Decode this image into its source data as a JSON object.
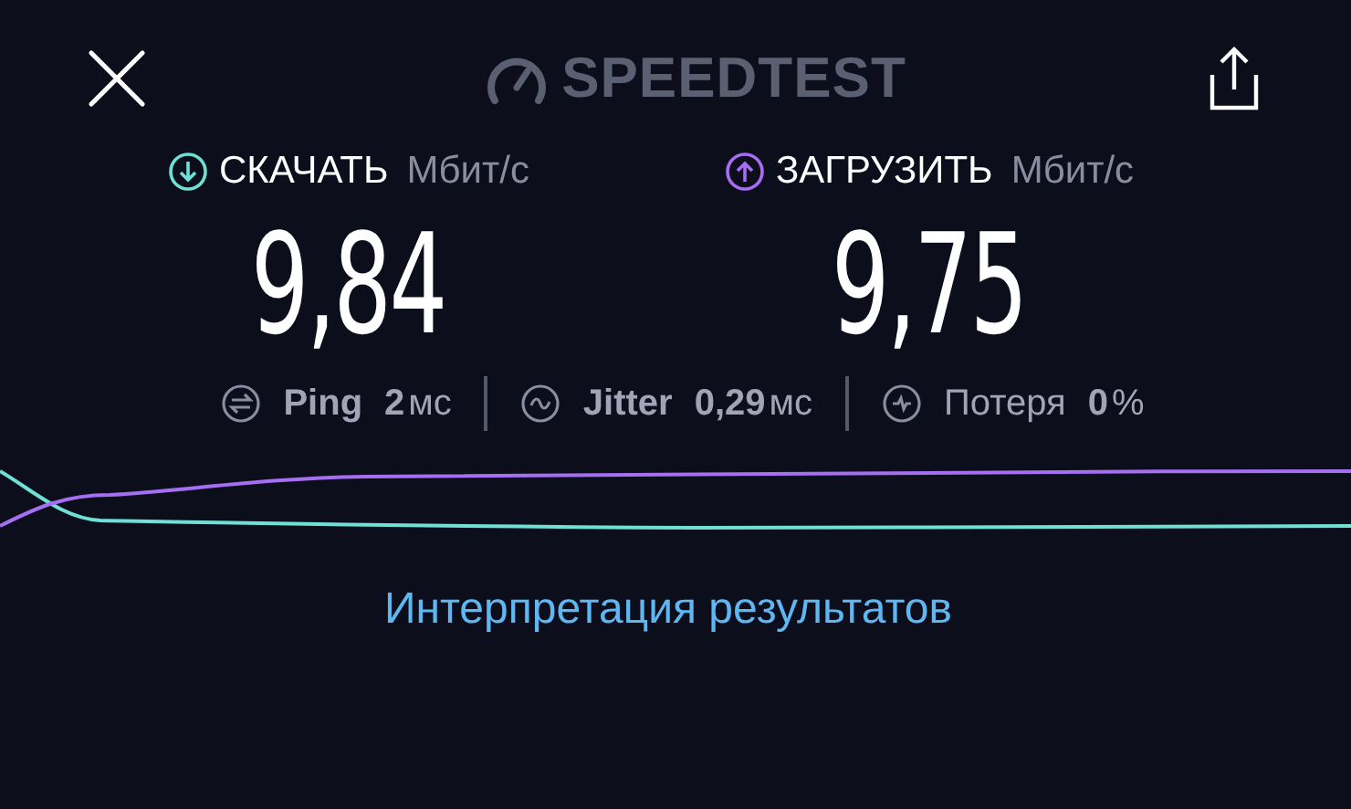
{
  "header": {
    "title": "SPEEDTEST"
  },
  "results": [
    {
      "kind": "download",
      "label": "СКАЧАТЬ",
      "unit": "Мбит/с",
      "value": "9,84"
    },
    {
      "kind": "upload",
      "label": "ЗАГРУЗИТЬ",
      "unit": "Мбит/с",
      "value": "9,75"
    }
  ],
  "stats": [
    {
      "kind": "ping",
      "label": "Ping",
      "label_bold": true,
      "value": "2",
      "unit": "мс"
    },
    {
      "kind": "jitter",
      "label": "Jitter",
      "label_bold": true,
      "value": "0,29",
      "unit": "мс"
    },
    {
      "kind": "loss",
      "label": "Потеря",
      "label_bold": false,
      "value": "0",
      "unit": "%"
    }
  ],
  "link": "Интерпретация результатов"
}
